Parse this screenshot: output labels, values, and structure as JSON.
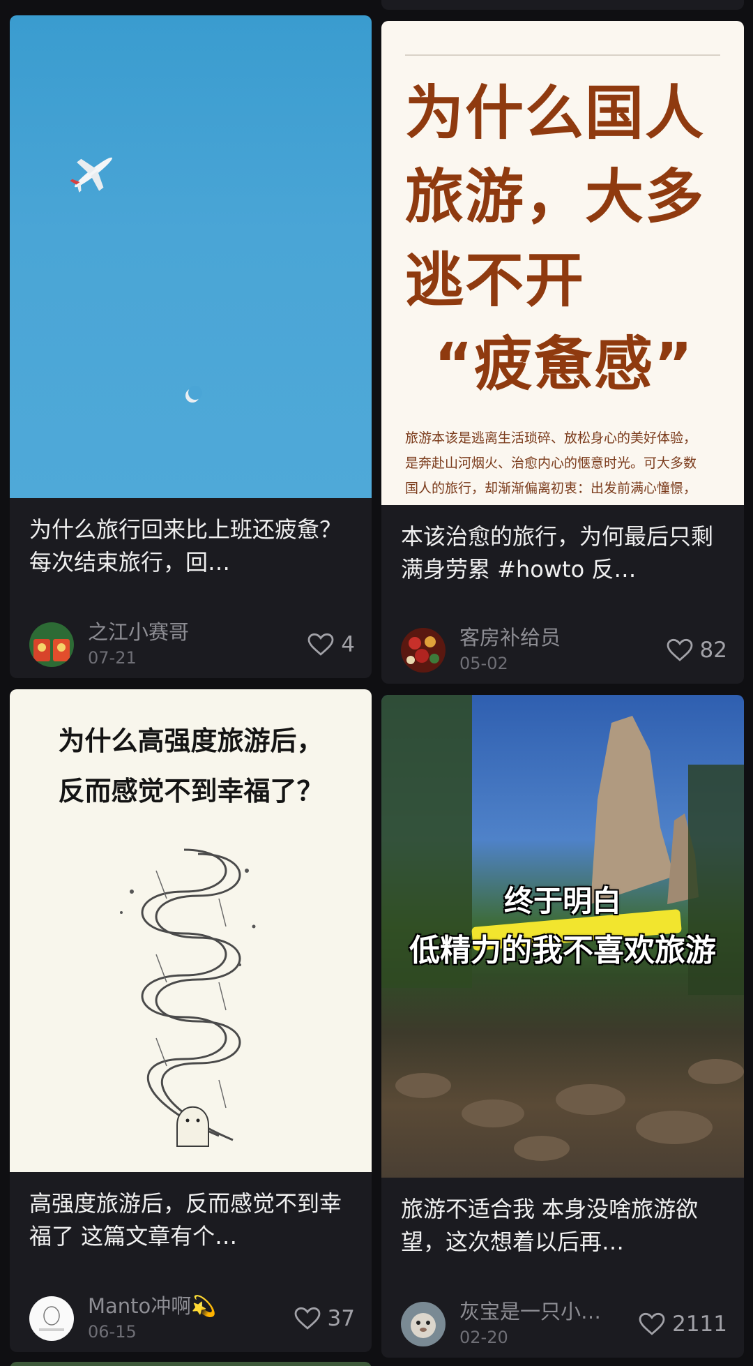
{
  "colors": {
    "background": "#0f0f12",
    "card": "#1b1b20",
    "title_text": "#f0f0f0",
    "meta_text": "#8e8e94",
    "poster_brown": "#8f3a0f"
  },
  "icons": {
    "like": "heart-outline-icon"
  },
  "cards": [
    {
      "title": "为什么旅行回来比上班还疲惫？ 每次结束旅行，回…",
      "author": "之江小赛哥",
      "date": "07-21",
      "likes": "4"
    },
    {
      "title": "本该治愈的旅行，为何最后只剩满身劳累 #howto 反…",
      "author": "客房补给员",
      "date": "05-02",
      "likes": "82",
      "cover": {
        "headline_lines": [
          "为什么国人",
          "旅游，大多",
          "逃不开",
          "“疲惫感”"
        ],
        "body_lines": [
          "旅游本该是逃离生活琐碎、放松身心的美好体验，",
          "是奔赴山河烟火、治愈内心的惬意时光。可大多数",
          "国人的旅行，却渐渐偏离初衷：出发前满心憧憬，"
        ]
      }
    },
    {
      "title": "高强度旅游后，反而感觉不到幸福了 这篇文章有个…",
      "author": "Manto冲啊💫",
      "date": "06-15",
      "likes": "37",
      "cover": {
        "question_lines": [
          "为什么高强度旅游后，",
          "反而感觉不到幸福了？"
        ]
      }
    },
    {
      "title": "旅游不适合我 本身没啥旅游欲望，这次想着以后再…",
      "author": "灰宝是一只小…",
      "date": "02-20",
      "likes": "2111",
      "cover": {
        "caption_lines": [
          "终于明白",
          "低精力的我不喜欢旅游"
        ]
      }
    }
  ]
}
